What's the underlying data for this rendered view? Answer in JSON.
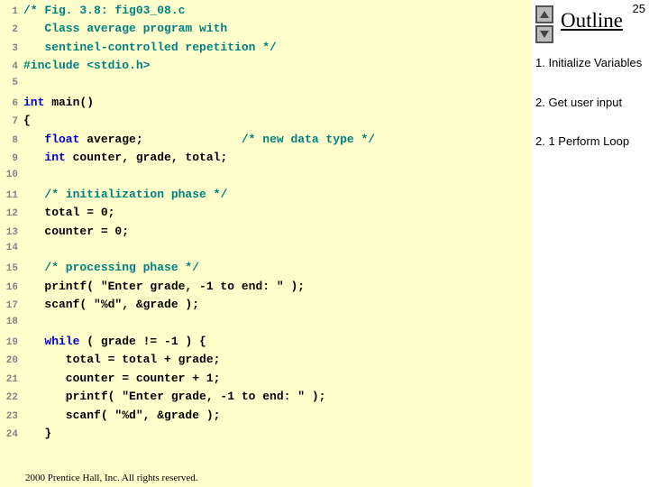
{
  "page_number": "25",
  "outline": {
    "title": "Outline",
    "items": [
      "1.  Initialize Variables",
      "2.  Get user input",
      "2. 1  Perform Loop"
    ]
  },
  "copyright": "  2000 Prentice Hall, Inc.  All rights reserved.",
  "code": [
    {
      "n": "1",
      "tokens": [
        {
          "cls": "cmt",
          "t": "/* Fig. 3.8: fig03_08.c"
        }
      ]
    },
    {
      "n": "2",
      "tokens": [
        {
          "cls": "cmt",
          "t": "   Class average program with"
        }
      ]
    },
    {
      "n": "3",
      "tokens": [
        {
          "cls": "cmt",
          "t": "   sentinel-controlled repetition */"
        }
      ]
    },
    {
      "n": "4",
      "tokens": [
        {
          "cls": "pp",
          "t": "#include "
        },
        {
          "cls": "pp",
          "t": "<stdio.h>"
        }
      ]
    },
    {
      "n": "5",
      "tokens": []
    },
    {
      "n": "6",
      "tokens": [
        {
          "cls": "kw",
          "t": "int"
        },
        {
          "cls": "pl",
          "t": " main()"
        }
      ]
    },
    {
      "n": "7",
      "tokens": [
        {
          "cls": "pl",
          "t": "{"
        }
      ]
    },
    {
      "n": "8",
      "tokens": [
        {
          "cls": "pl",
          "t": "   "
        },
        {
          "cls": "kw",
          "t": "float"
        },
        {
          "cls": "pl",
          "t": " average;              "
        },
        {
          "cls": "cmt",
          "t": "/* new data type */"
        }
      ]
    },
    {
      "n": "9",
      "tokens": [
        {
          "cls": "pl",
          "t": "   "
        },
        {
          "cls": "kw",
          "t": "int"
        },
        {
          "cls": "pl",
          "t": " counter, grade, total;"
        }
      ]
    },
    {
      "n": "10",
      "tokens": []
    },
    {
      "n": "11",
      "tokens": [
        {
          "cls": "pl",
          "t": "   "
        },
        {
          "cls": "cmt",
          "t": "/* initialization phase */"
        }
      ]
    },
    {
      "n": "12",
      "tokens": [
        {
          "cls": "pl",
          "t": "   total = 0;"
        }
      ]
    },
    {
      "n": "13",
      "tokens": [
        {
          "cls": "pl",
          "t": "   counter = 0;"
        }
      ]
    },
    {
      "n": "14",
      "tokens": []
    },
    {
      "n": "15",
      "tokens": [
        {
          "cls": "pl",
          "t": "   "
        },
        {
          "cls": "cmt",
          "t": "/* processing phase */"
        }
      ]
    },
    {
      "n": "16",
      "tokens": [
        {
          "cls": "pl",
          "t": "   printf( \"Enter grade, -1 to end: \" );"
        }
      ]
    },
    {
      "n": "17",
      "tokens": [
        {
          "cls": "pl",
          "t": "   scanf( \"%d\", &grade );"
        }
      ]
    },
    {
      "n": "18",
      "tokens": []
    },
    {
      "n": "19",
      "tokens": [
        {
          "cls": "pl",
          "t": "   "
        },
        {
          "cls": "kw",
          "t": "while"
        },
        {
          "cls": "pl",
          "t": " ( grade != -1 ) {"
        }
      ]
    },
    {
      "n": "20",
      "tokens": [
        {
          "cls": "pl",
          "t": "      total = total + grade;"
        }
      ]
    },
    {
      "n": "21",
      "tokens": [
        {
          "cls": "pl",
          "t": "      counter = counter + 1;"
        }
      ]
    },
    {
      "n": "22",
      "tokens": [
        {
          "cls": "pl",
          "t": "      printf( \"Enter grade, -1 to end: \" );"
        }
      ]
    },
    {
      "n": "23",
      "tokens": [
        {
          "cls": "pl",
          "t": "      scanf( \"%d\", &grade );"
        }
      ]
    },
    {
      "n": "24",
      "tokens": [
        {
          "cls": "pl",
          "t": "   } "
        }
      ]
    }
  ]
}
